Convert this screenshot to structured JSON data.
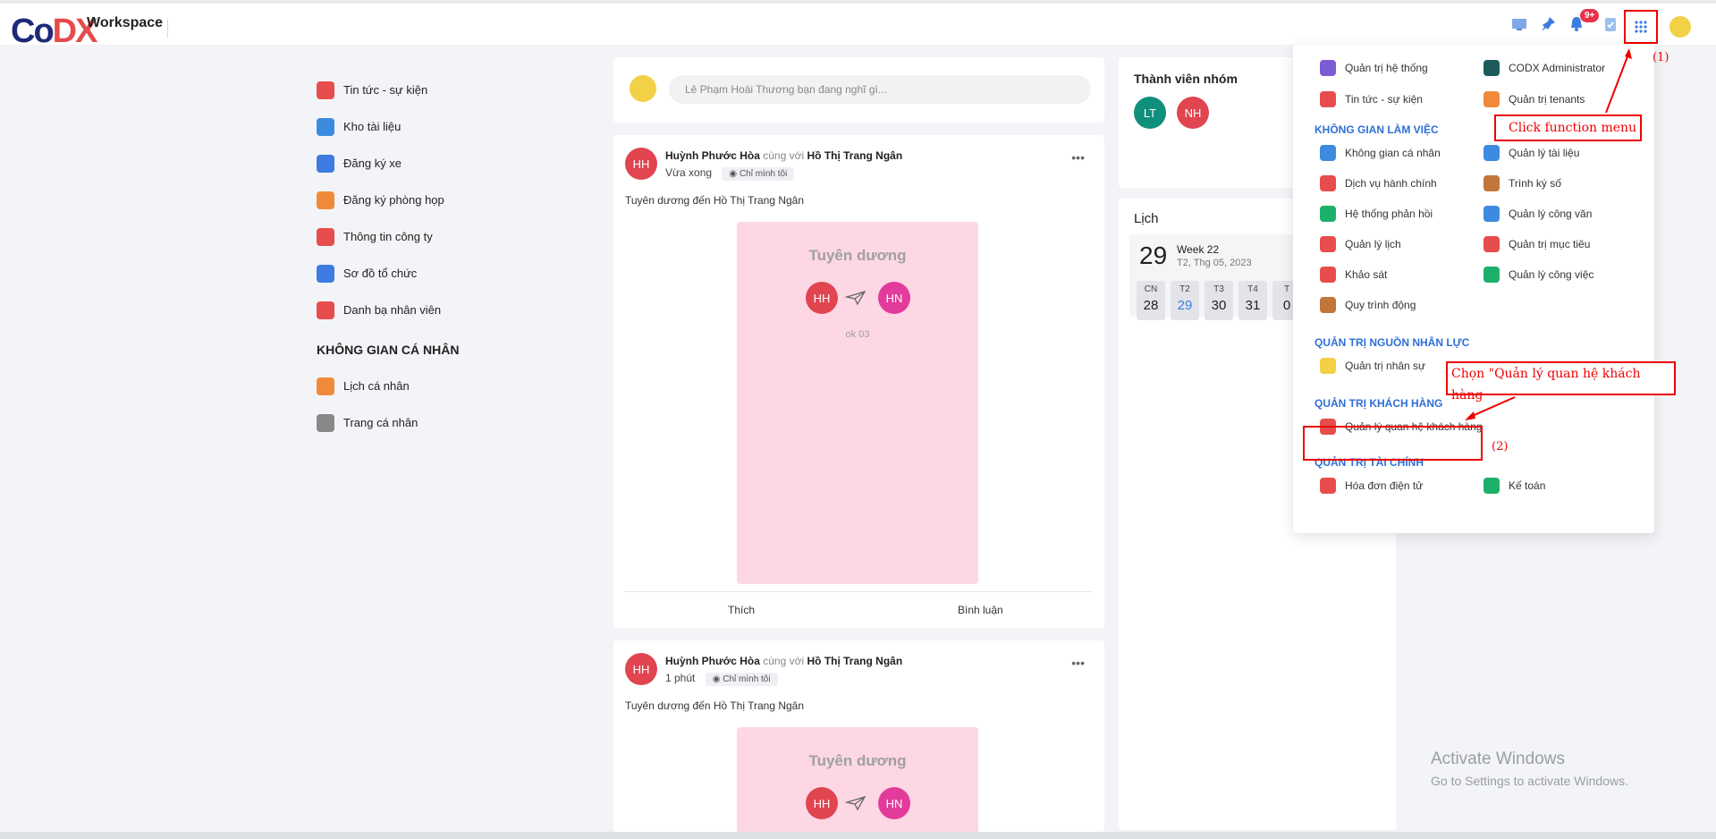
{
  "header": {
    "logo_text": "CoDX",
    "workspace": "Workspace",
    "notif_badge": "9+",
    "icons": [
      "monitor-icon",
      "pin-icon",
      "bell-icon",
      "clipboard-check-icon",
      "apps-grid-icon",
      "user-avatar-icon"
    ]
  },
  "leftnav": {
    "items": [
      {
        "label": "Tin tức - sự kiện",
        "icon": "megaphone-icon",
        "color": "#e84d4d"
      },
      {
        "label": "Kho tài liệu",
        "icon": "cloud-docs-icon",
        "color": "#3d8be0"
      },
      {
        "label": "Đăng ký xe",
        "icon": "car-icon",
        "color": "#3d7be0"
      },
      {
        "label": "Đăng ký phòng họp",
        "icon": "meeting-room-icon",
        "color": "#f08a3a"
      },
      {
        "label": "Thông tin công ty",
        "icon": "building-icon",
        "color": "#e84d4d"
      },
      {
        "label": "Sơ đồ tổ chức",
        "icon": "org-chart-icon",
        "color": "#3d7be0"
      },
      {
        "label": "Danh bạ nhân viên",
        "icon": "contacts-icon",
        "color": "#e84d4d"
      }
    ],
    "section_title": "KHÔNG GIAN CÁ NHÂN",
    "personal": [
      {
        "label": "Lịch cá nhân",
        "icon": "calendar-icon",
        "color": "#f08a3a"
      },
      {
        "label": "Trang cá nhân",
        "icon": "user-icon",
        "color": "#888888"
      }
    ]
  },
  "composer": {
    "placeholder": "Lê Phạm Hoài Thương bạn đang nghĩ gì..."
  },
  "posts": [
    {
      "author": "Huỳnh Phước Hòa",
      "with_word": "cùng với",
      "with_name": "Hồ Thị Trang Ngân",
      "time": "Vừa xong",
      "privacy": "Chỉ mình tôi",
      "text": "Tuyên dương đến Hồ Thị Trang Ngân",
      "author_initials": "HH",
      "praise_title": "Tuyên dương",
      "from_initials": "HH",
      "to_initials": "HN",
      "note": "ok 03",
      "like": "Thích",
      "comment": "Bình luận"
    },
    {
      "author": "Huỳnh Phước Hòa",
      "with_word": "cùng với",
      "with_name": "Hồ Thị Trang Ngân",
      "time": "1 phút",
      "privacy": "Chỉ mình tôi",
      "text": "Tuyên dương đến Hồ Thị Trang Ngân",
      "author_initials": "HH",
      "praise_title": "Tuyên dương",
      "from_initials": "HH",
      "to_initials": "HN"
    }
  ],
  "members": {
    "title": "Thành viên nhóm",
    "list": [
      "LT",
      "NH"
    ]
  },
  "calendar": {
    "title": "Lịch",
    "day": "29",
    "week": "Week 22",
    "date": "T2, Thg 05, 2023",
    "days": [
      {
        "name": "CN",
        "num": "28"
      },
      {
        "name": "T2",
        "num": "29",
        "today": true
      },
      {
        "name": "T3",
        "num": "30"
      },
      {
        "name": "T4",
        "num": "31"
      },
      {
        "name": "T",
        "num": "0"
      }
    ]
  },
  "menu": {
    "top": [
      {
        "label": "Quản trị hệ thống",
        "icon": "system-admin-icon",
        "color": "#7b5cd6"
      },
      {
        "label": "CODX Administrator",
        "icon": "admin-icon",
        "color": "#1d5a5a"
      },
      {
        "label": "Tin tức - sự kiện",
        "icon": "megaphone-icon",
        "color": "#e84d4d"
      },
      {
        "label": "Quản trị tenants",
        "icon": "tenants-icon",
        "color": "#f08a3a"
      }
    ],
    "sections": [
      {
        "title": "KHÔNG GIAN LÀM VIỆC",
        "items": [
          {
            "label": "Không gian cá nhân",
            "icon": "globe-icon",
            "color": "#3d8be0"
          },
          {
            "label": "Quản lý tài liệu",
            "icon": "docs-icon",
            "color": "#3d8be0"
          },
          {
            "label": "Dịch vụ hành chính",
            "icon": "service-icon",
            "color": "#e84d4d"
          },
          {
            "label": "Trình ký số",
            "icon": "sign-icon",
            "color": "#c2763a"
          },
          {
            "label": "Hệ thống phản hồi",
            "icon": "feedback-icon",
            "color": "#1db06a"
          },
          {
            "label": "Quản lý công văn",
            "icon": "dispatch-icon",
            "color": "#3d8be0"
          },
          {
            "label": "Quản lý lịch",
            "icon": "calendar-icon",
            "color": "#e84d4d"
          },
          {
            "label": "Quản trị mục tiêu",
            "icon": "target-icon",
            "color": "#e84d4d"
          },
          {
            "label": "Khảo sát",
            "icon": "survey-icon",
            "color": "#e84d4d"
          },
          {
            "label": "Quản lý công việc",
            "icon": "task-icon",
            "color": "#1db06a"
          },
          {
            "label": "Quy trình động",
            "icon": "workflow-icon",
            "color": "#c2763a"
          }
        ]
      },
      {
        "title": "QUẢN TRỊ NGUỒN NHÂN LỰC",
        "items": [
          {
            "label": "Quản trị nhân sự",
            "icon": "hr-icon",
            "color": "#f2d147"
          }
        ]
      },
      {
        "title": "QUẢN TRỊ KHÁCH HÀNG",
        "items": [
          {
            "label": "Quản lý quan hệ khách hàng",
            "icon": "crm-icon",
            "color": "#e84d4d"
          }
        ]
      },
      {
        "title": "QUẢN TRỊ TÀI CHÍNH",
        "items": [
          {
            "label": "Hóa đơn điện tử",
            "icon": "invoice-icon",
            "color": "#e84d4d"
          },
          {
            "label": "Kế toán",
            "icon": "accounting-icon",
            "color": "#1db06a"
          }
        ]
      }
    ]
  },
  "annotations": {
    "click_menu": "Click function menu",
    "num1": "(1)",
    "choose": "Chọn \"Quản lý quan hệ khách hàng",
    "num2": "(2)"
  },
  "watermark": {
    "line1": "Activate Windows",
    "line2": "Go to Settings to activate Windows."
  }
}
